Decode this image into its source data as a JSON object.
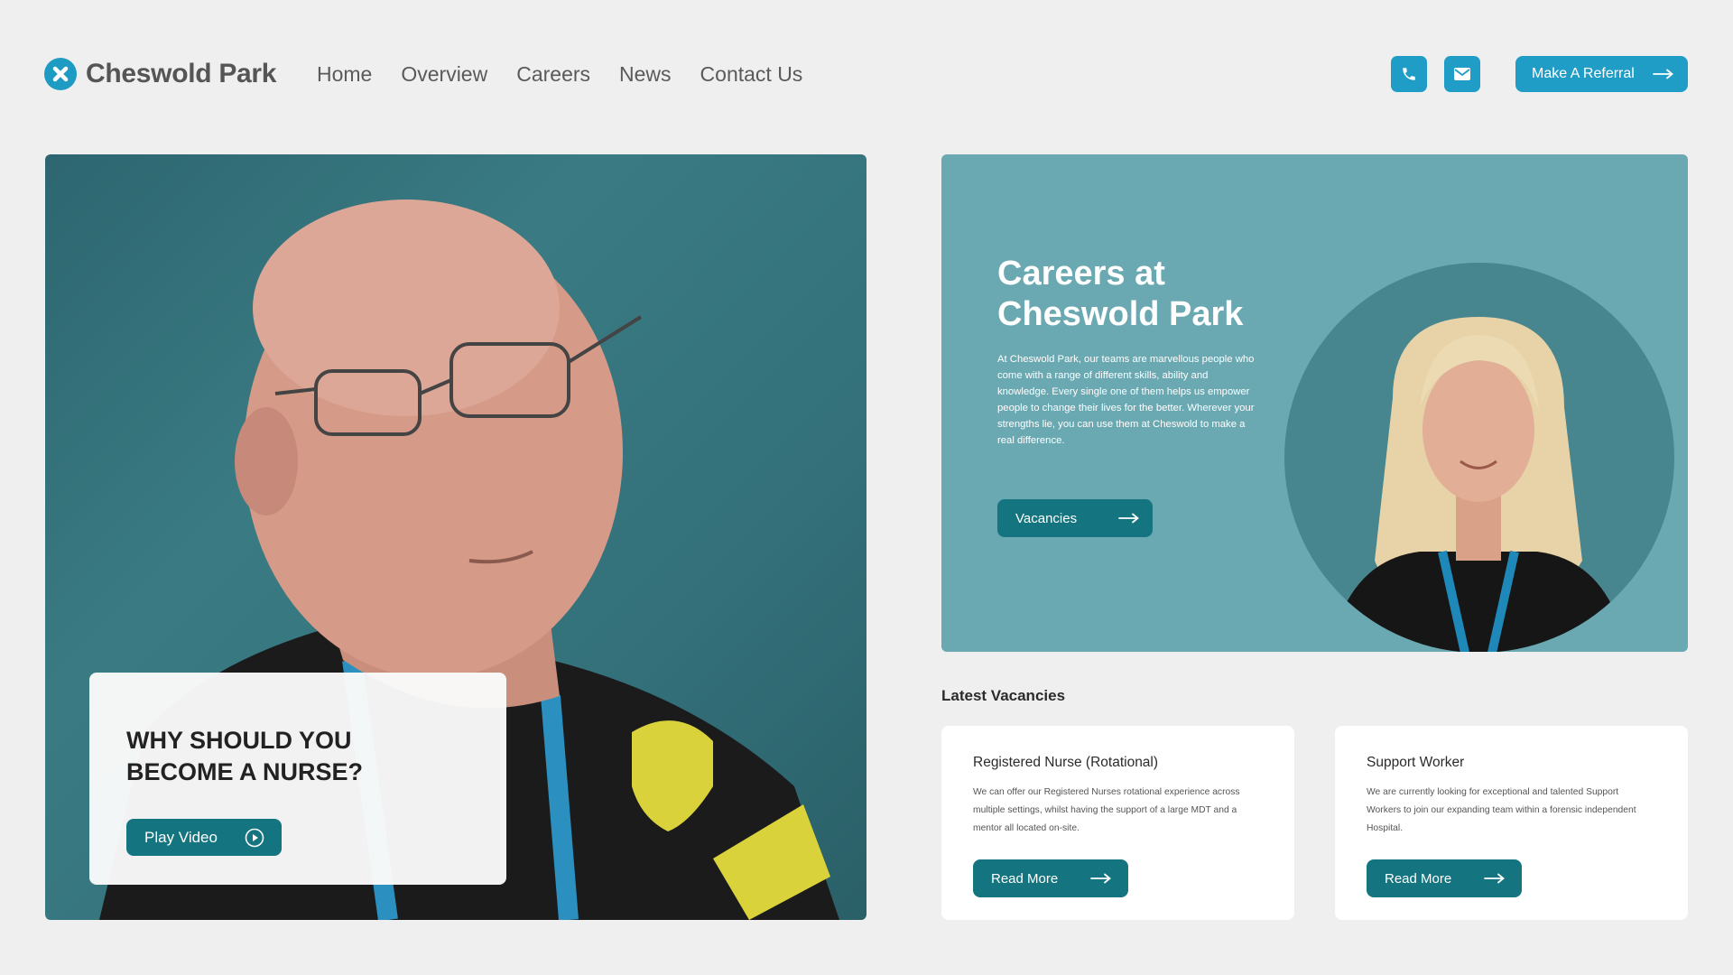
{
  "brand": {
    "name": "Cheswold Park",
    "accent_color": "#1f9dc7",
    "button_color": "#14747f",
    "banner_color": "#6aa8b2"
  },
  "nav": {
    "items": [
      "Home",
      "Overview",
      "Careers",
      "News",
      "Contact Us"
    ]
  },
  "header": {
    "phone_icon": "phone-icon",
    "mail_icon": "mail-icon",
    "referral_label": "Make A Referral"
  },
  "hero": {
    "card_title": "WHY SHOULD YOU BECOME A NURSE?",
    "play_label": "Play Video"
  },
  "careers": {
    "heading": "Careers at Cheswold Park",
    "body": "At Cheswold Park, our teams are marvellous people who come with a range of different skills, ability and knowledge. Every single one of them helps us empower people to change their lives for the better. Wherever your strengths lie, you can use them at Cheswold to make a real difference.",
    "button_label": "Vacancies"
  },
  "vacancies": {
    "section_title": "Latest Vacancies",
    "items": [
      {
        "title": "Registered Nurse (Rotational)",
        "description": "We can offer our Registered Nurses rotational experience across multiple settings, whilst having the support of a large MDT and a mentor all located on-site.",
        "button_label": "Read More"
      },
      {
        "title": "Support Worker",
        "description": "We are currently looking for exceptional and talented Support Workers to join our expanding team within a forensic independent Hospital.",
        "button_label": "Read More"
      }
    ]
  }
}
